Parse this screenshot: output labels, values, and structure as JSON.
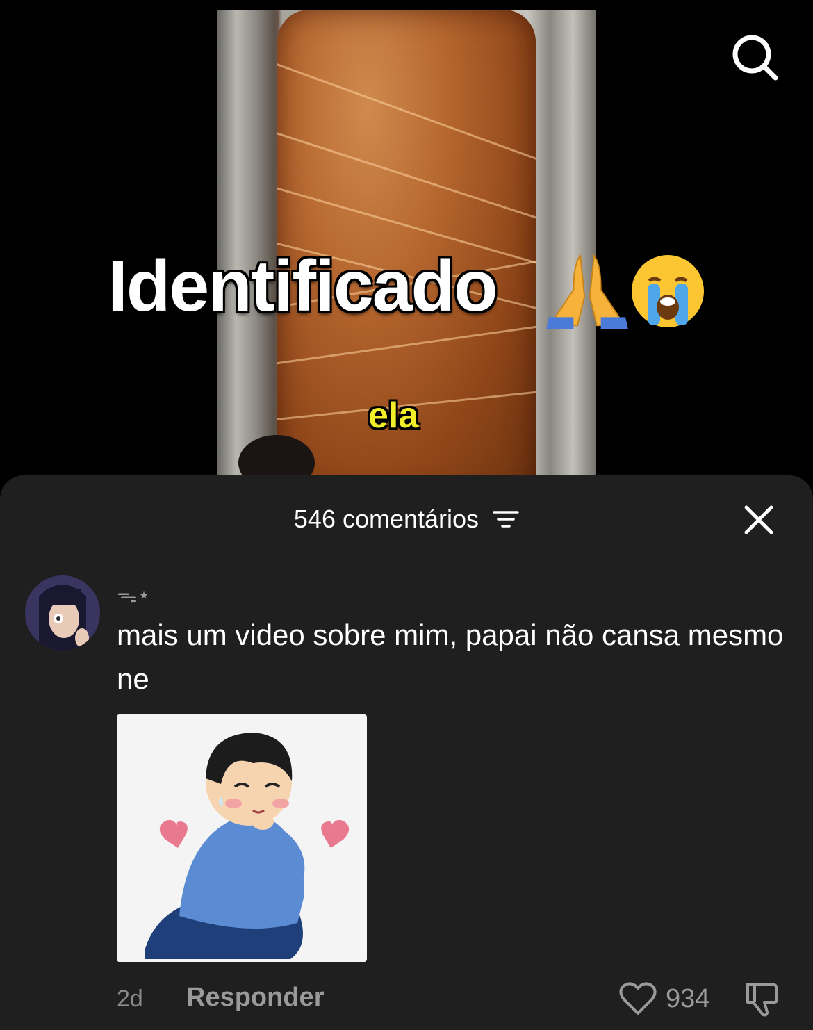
{
  "video": {
    "overlay_title": "Identificado",
    "overlay_emojis": [
      "folded-hands-emoji",
      "loudly-crying-face-emoji"
    ],
    "caption": "ela",
    "search_icon": "search-icon"
  },
  "comments": {
    "header": "546 comentários",
    "sort_icon": "sort-filter-icon",
    "close_icon": "close-icon",
    "items": [
      {
        "username": "ᯓ⋆",
        "text": "mais um video sobre mim, papai não cansa mesmo ne",
        "time": "2d",
        "reply_label": "Responder",
        "likes": "934",
        "sticker": "blushing-man-sticker"
      }
    ]
  },
  "colors": {
    "background": "#000000",
    "sheet": "#1f1f1f",
    "caption_yellow": "#f3ee2a",
    "muted_text": "#9a9a9a"
  }
}
